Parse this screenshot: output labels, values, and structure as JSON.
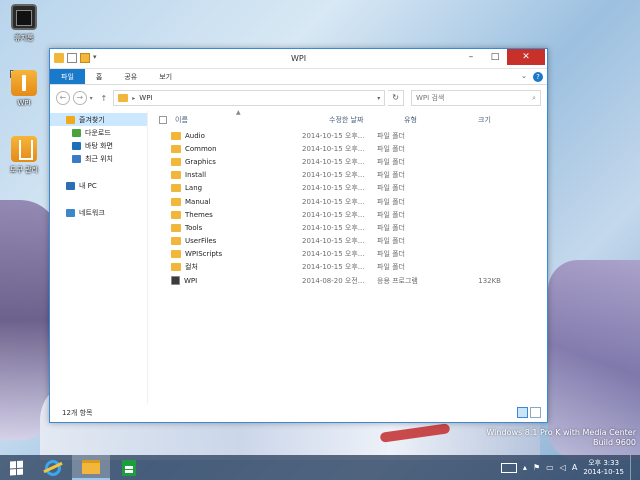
{
  "desktop": {
    "icons": [
      {
        "label": "휴지통"
      },
      {
        "label": "WPI"
      },
      {
        "label": "도구 관리"
      }
    ]
  },
  "window": {
    "title": "WPI",
    "ribbon_tabs": [
      "파일",
      "홈",
      "공유",
      "보기"
    ],
    "address": {
      "path": "WPI"
    },
    "search": {
      "placeholder": "WPI 검색"
    },
    "nav": {
      "favorites": "즐겨찾기",
      "downloads": "다운로드",
      "desktop": "바탕 화면",
      "recent": "최근 위치",
      "mypc": "내 PC",
      "network": "네트워크"
    },
    "columns": {
      "name": "이름",
      "date": "수정한 날짜",
      "type": "유형",
      "size": "크기"
    },
    "files": [
      {
        "name": "Audio",
        "date": "2014-10-15 오후...",
        "type": "파일 폴더",
        "size": "",
        "kind": "folder"
      },
      {
        "name": "Common",
        "date": "2014-10-15 오후...",
        "type": "파일 폴더",
        "size": "",
        "kind": "folder"
      },
      {
        "name": "Graphics",
        "date": "2014-10-15 오후...",
        "type": "파일 폴더",
        "size": "",
        "kind": "folder"
      },
      {
        "name": "Install",
        "date": "2014-10-15 오후...",
        "type": "파일 폴더",
        "size": "",
        "kind": "folder"
      },
      {
        "name": "Lang",
        "date": "2014-10-15 오후...",
        "type": "파일 폴더",
        "size": "",
        "kind": "folder"
      },
      {
        "name": "Manual",
        "date": "2014-10-15 오후...",
        "type": "파일 폴더",
        "size": "",
        "kind": "folder"
      },
      {
        "name": "Themes",
        "date": "2014-10-15 오후...",
        "type": "파일 폴더",
        "size": "",
        "kind": "folder"
      },
      {
        "name": "Tools",
        "date": "2014-10-15 오후...",
        "type": "파일 폴더",
        "size": "",
        "kind": "folder"
      },
      {
        "name": "UserFiles",
        "date": "2014-10-15 오후...",
        "type": "파일 폴더",
        "size": "",
        "kind": "folder"
      },
      {
        "name": "WPIScripts",
        "date": "2014-10-15 오후...",
        "type": "파일 폴더",
        "size": "",
        "kind": "folder"
      },
      {
        "name": "컬처",
        "date": "2014-10-15 오후...",
        "type": "파일 폴더",
        "size": "",
        "kind": "folder"
      },
      {
        "name": "WPI",
        "date": "2014-08-20 오전...",
        "type": "응용 프로그램",
        "size": "132KB",
        "kind": "app"
      }
    ],
    "status": "12개 항목"
  },
  "watermark": {
    "line1": "Windows 8.1 Pro K with Media Center",
    "line2": "Build 9600"
  },
  "taskbar": {
    "clock_time": "오후 3:33",
    "clock_date": "2014-10-15"
  },
  "colors": {
    "accent": "#1979ca",
    "close": "#c7312a",
    "folder": "#f2b63b"
  }
}
